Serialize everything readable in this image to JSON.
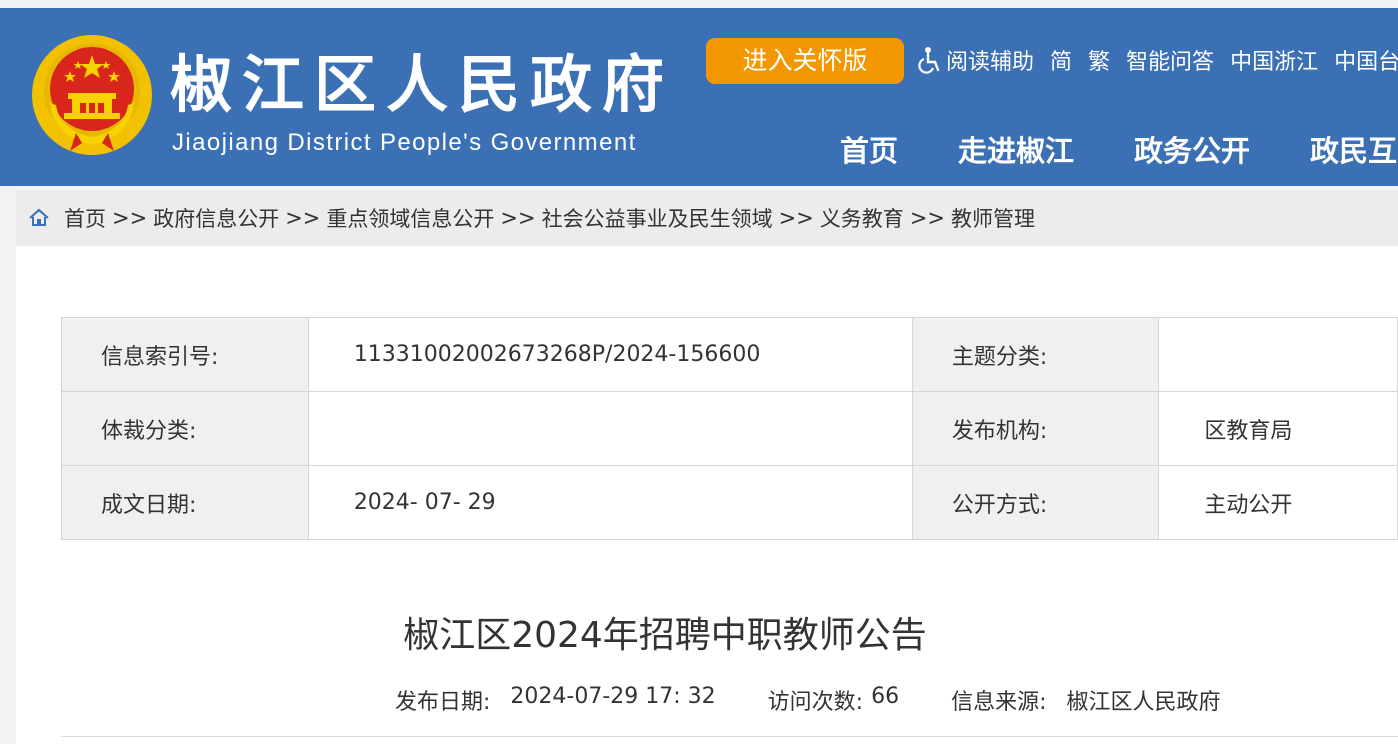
{
  "header": {
    "title": "椒江区人民政府",
    "subtitle": "Jiaojiang District People's Government",
    "care_button": "进入关怀版",
    "top_links": [
      "阅读辅助",
      "简",
      "繁",
      "智能问答",
      "中国浙江",
      "中国台"
    ],
    "nav": [
      "首页",
      "走进椒江",
      "政务公开",
      "政民互"
    ],
    "colors": {
      "header_bg": "#3b71b4",
      "care_button_bg": "#f39700"
    }
  },
  "breadcrumb": {
    "items": [
      "首页",
      "政府信息公开",
      "重点领域信息公开",
      "社会公益事业及民生领域",
      "义务教育",
      "教师管理"
    ],
    "separator": ">>"
  },
  "info_table": {
    "rows": [
      {
        "label1": "信息索引号:",
        "value1": "11331002002673268P/2024-156600",
        "label2": "主题分类:",
        "value2": ""
      },
      {
        "label1": "体裁分类:",
        "value1": "",
        "label2": "发布机构:",
        "value2": "区教育局"
      },
      {
        "label1": "成文日期:",
        "value1": "2024- 07- 29",
        "label2": "公开方式:",
        "value2": "主动公开"
      }
    ]
  },
  "article": {
    "title": "椒江区2024年招聘中职教师公告",
    "publish_label": "发布日期:",
    "publish_value": "2024-07-29 17: 32",
    "visits_label": "访问次数:",
    "visits_value": "66",
    "source_label": "信息来源:",
    "source_value": "椒江区人民政府"
  }
}
